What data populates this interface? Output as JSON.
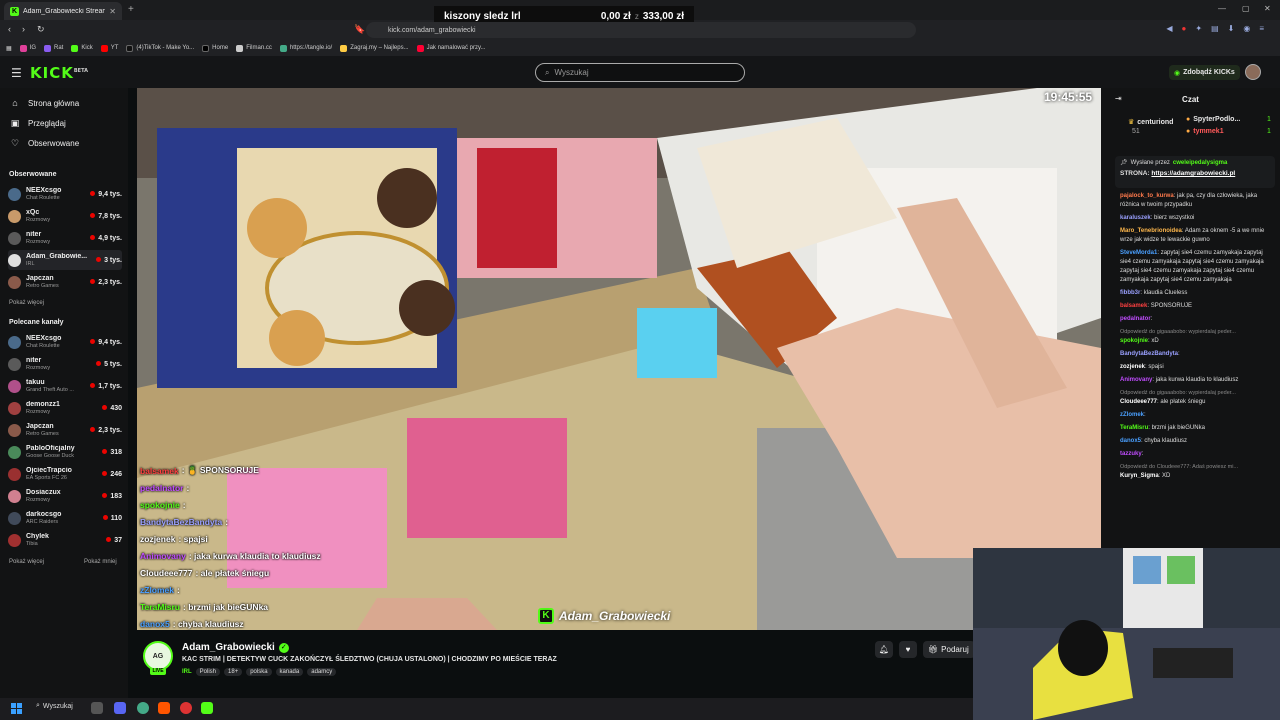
{
  "browser": {
    "tab_title": "Adam_Grabowiecki Stream -",
    "url": "kick.com/adam_grabowiecki",
    "bookmarks": [
      "IG",
      "Rat",
      "Kick",
      "YT",
      "(4)TikTok - Make Yo...",
      "Home",
      "Filman.cc",
      "https://tangle.io/",
      "Zagraj.my – Najleps...",
      "Jak namalować przy..."
    ]
  },
  "donation_bar": {
    "label": "kiszony sledz lrl",
    "current": "0,00 zł",
    "separator": "z",
    "goal": "333,00 zł"
  },
  "header": {
    "logo": "KICK",
    "logo_sup": "BETA",
    "search_placeholder": "Wyszukaj",
    "get_kicks": "Zdobądź KICKs"
  },
  "sidebar": {
    "nav": [
      {
        "label": "Strona główna",
        "icon": "home-icon"
      },
      {
        "label": "Przeglądaj",
        "icon": "browse-icon"
      },
      {
        "label": "Obserwowane",
        "icon": "heart-icon"
      }
    ],
    "followed_title": "Obserwowane",
    "followed": [
      {
        "name": "NEEXcsgo",
        "category": "Chat Roulette",
        "viewers": "9,4 tys.",
        "color": "#4a6a8a"
      },
      {
        "name": "xQc",
        "category": "Rozmowy",
        "viewers": "7,8 tys.",
        "color": "#c89a6a"
      },
      {
        "name": "niter",
        "category": "Rozmowy",
        "viewers": "4,9 tys.",
        "color": "#5a5a5a"
      },
      {
        "name": "Adam_Grabowie...",
        "category": "IRL",
        "viewers": "3 tys.",
        "color": "#e0e0e0"
      },
      {
        "name": "Japczan",
        "category": "Retro Games",
        "viewers": "2,3 tys.",
        "color": "#8a5a4a"
      }
    ],
    "show_more": "Pokaż więcej",
    "recommended_title": "Polecane kanały",
    "recommended": [
      {
        "name": "NEEXcsgo",
        "category": "Chat Roulette",
        "viewers": "9,4 tys.",
        "color": "#4a6a8a"
      },
      {
        "name": "niter",
        "category": "Rozmowy",
        "viewers": "5 tys.",
        "color": "#5a5a5a"
      },
      {
        "name": "takuu",
        "category": "Grand Theft Auto ...",
        "viewers": "1,7 tys.",
        "color": "#b0508a"
      },
      {
        "name": "demonzz1",
        "category": "Rozmowy",
        "viewers": "430",
        "color": "#a04040"
      },
      {
        "name": "Japczan",
        "category": "Retro Games",
        "viewers": "2,3 tys.",
        "color": "#8a5a4a"
      },
      {
        "name": "PabloOficjalny",
        "category": "Goose Goose Duck",
        "viewers": "318",
        "color": "#4a8a5a"
      },
      {
        "name": "OjciecTrapcio",
        "category": "EA Sports FC 26",
        "viewers": "246",
        "color": "#9a3030"
      },
      {
        "name": "Dosiaczux",
        "category": "Rozmowy",
        "viewers": "183",
        "color": "#d08090"
      },
      {
        "name": "darkocsgo",
        "category": "ARC Raiders",
        "viewers": "110",
        "color": "#404a5a"
      },
      {
        "name": "Chylek",
        "category": "Tibia",
        "viewers": "37",
        "color": "#a03030"
      }
    ],
    "show_more2": "Pokaż więcej",
    "show_less": "Pokaż mniej"
  },
  "player": {
    "clock": "19:45:55",
    "watermark": "Adam_Grabowiecki",
    "overlay_chat": [
      {
        "user": "balsamek",
        "text": ": 🍍 SPONSORUJE",
        "color": "#ff4040"
      },
      {
        "user": "pedalnator",
        "text": ":",
        "color": "#c04cff"
      },
      {
        "user": "spokojnie",
        "text": ":",
        "color": "#53fc18"
      },
      {
        "user": "BandytaBezBandyta",
        "text": ":",
        "color": "#9aa0ff"
      },
      {
        "user": "zozjenek",
        "text": ": spajsi",
        "color": "#ffffff"
      },
      {
        "user": "Animovany",
        "text": ": jaka kurwa klaudia to klaudiusz",
        "color": "#c04cff"
      },
      {
        "user": "Cloudeee777",
        "text": ": ale płatek śniegu",
        "color": "#ffffff"
      },
      {
        "user": "zZlomek",
        "text": ":",
        "color": "#4aa0ff"
      },
      {
        "user": "TeraMisru",
        "text": ": brzmi jak bieGUNka",
        "color": "#53fc18"
      },
      {
        "user": "danox5",
        "text": ": chyba klaudiusz",
        "color": "#4aa0ff"
      }
    ]
  },
  "channel": {
    "name": "Adam_Grabowiecki",
    "title": "KAC STRIM | DETEKTYW CUCK ZAKOŃCZYŁ ŚLEDZTWO (CHUJA USTALONO) | CHODZIMY PO MIEŚCIE TERAZ",
    "category": "IRL",
    "tags": [
      "Polish",
      "18+",
      "polska",
      "kanada",
      "adamcy"
    ],
    "gift_label": "Podaruj"
  },
  "chat": {
    "title": "Czat",
    "leaderboard": [
      {
        "user": "centuriond",
        "score": "51",
        "rank": "1"
      },
      {
        "user": "SpyterPodlo...",
        "score": "1"
      },
      {
        "user": "tymmek1",
        "score": "1"
      }
    ],
    "pinned_by_label": "Wysłane przez",
    "pinned_by": "cweleipedalysigma",
    "pinned_text": "STRONA:",
    "pinned_link": "https://adamgrabowiecki.pl",
    "messages": [
      {
        "user": "pajalock_to_kurwa",
        "text": "jak pa, czy dla człowieka, jaka różnica w twoim przypadku",
        "color": "#ff7a4c",
        "reply": ""
      },
      {
        "user": "karaluszek",
        "text": "bierz wszystkoi",
        "color": "#9aa0ff",
        "reply": ""
      },
      {
        "user": "Maro_Tenebrionoidea",
        "text": "Adam za oknem -5 a we mnie wrze jak widze te lewackie guwno",
        "color": "#ffb84c",
        "reply": ""
      },
      {
        "user": "SteveMorda1",
        "text": "zapytaj sie4 czemu zamyakaja zapytaj sie4 czemu zamyakaja zapytaj sie4 czemu zamyakaja zapytaj sie4 czemu zamyakaja zapytaj sie4 czemu zamyakaja zapytaj sie4 czemu zamyakaja",
        "color": "#4aa0ff",
        "reply": ""
      },
      {
        "user": "fibbb3r",
        "text": "klaudia Clueless",
        "color": "#9aa0ff",
        "reply": ""
      },
      {
        "user": "balsamek",
        "text": "SPONSORUJE",
        "color": "#ff4040",
        "reply": ""
      },
      {
        "user": "pedalnator",
        "text": "",
        "color": "#c04cff",
        "reply": ""
      },
      {
        "user": "spokojnie",
        "text": "xD",
        "color": "#53fc18",
        "reply": "Odpowiedź do gigaaabobo: wypierdalaj peder..."
      },
      {
        "user": "BandytaBezBandyta",
        "text": "",
        "color": "#9aa0ff",
        "reply": ""
      },
      {
        "user": "zozjenek",
        "text": "spajsi",
        "color": "#ffffff",
        "reply": ""
      },
      {
        "user": "Animovany",
        "text": "jaka kurwa klaudia to klaudiusz",
        "color": "#c04cff",
        "reply": ""
      },
      {
        "user": "Cloudeee777",
        "text": "ale płatek śniegu",
        "color": "#ffffff",
        "reply": "Odpowiedź do gigaaabobo: wypierdalaj peder..."
      },
      {
        "user": "zZlomek",
        "text": "",
        "color": "#4aa0ff",
        "reply": ""
      },
      {
        "user": "TeraMisru",
        "text": "brzmi jak bieGUNka",
        "color": "#53fc18",
        "reply": ""
      },
      {
        "user": "danox5",
        "text": "chyba klaudiusz",
        "color": "#4aa0ff",
        "reply": ""
      },
      {
        "user": "tazzuky",
        "text": "",
        "color": "#c04cff",
        "reply": ""
      },
      {
        "user": "Kuryn_Sigma",
        "text": "XD",
        "color": "#ffffff",
        "reply": "Odpowiedź do Cloudeee777: Adaś powiesz mi..."
      }
    ]
  },
  "taskbar": {
    "search": "Wyszukaj"
  }
}
